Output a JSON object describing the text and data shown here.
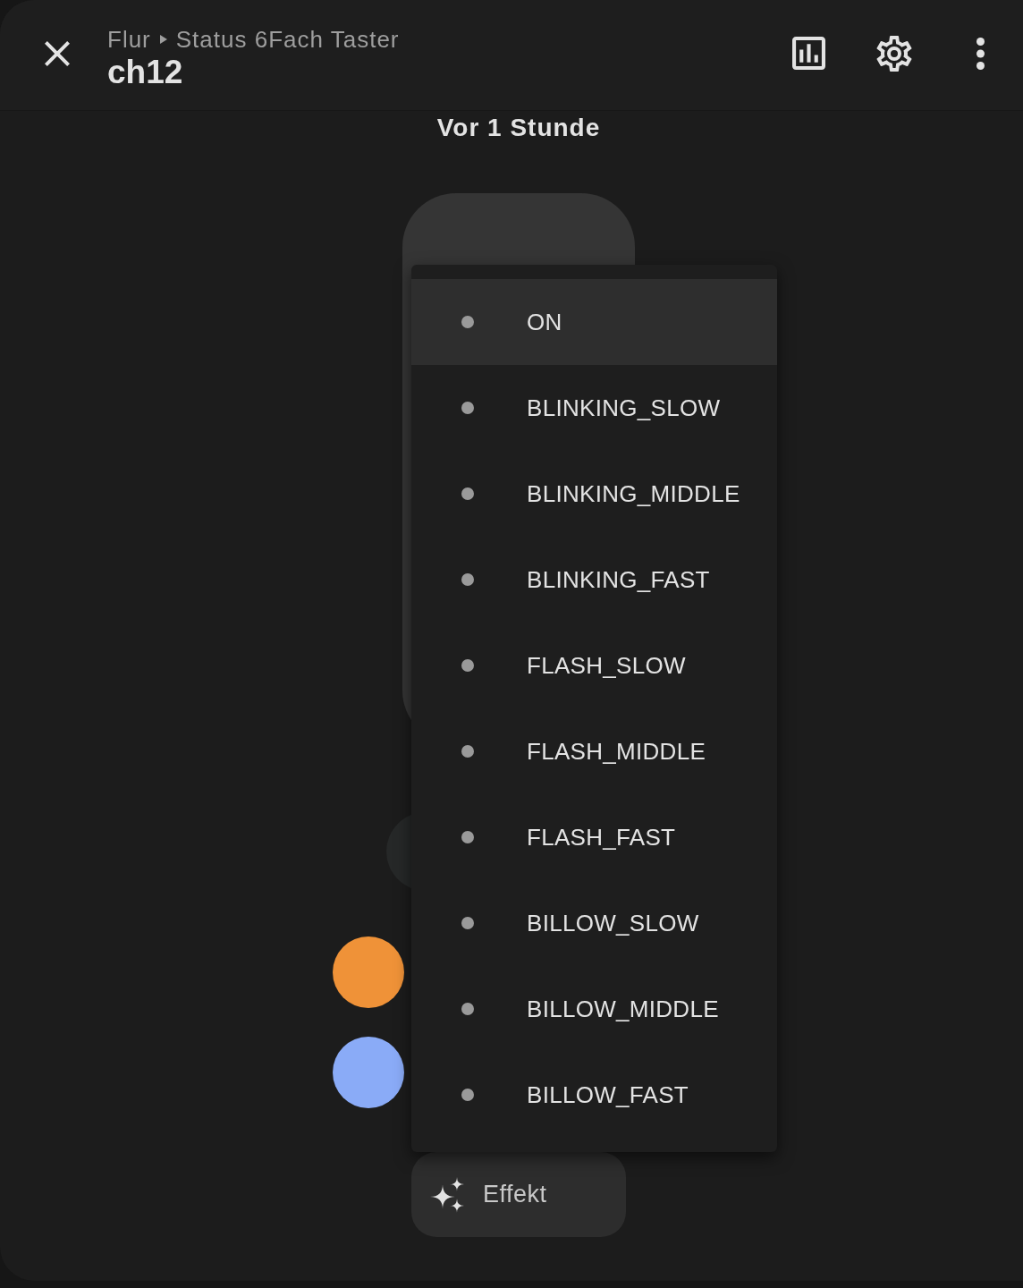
{
  "header": {
    "breadcrumb": [
      "Flur",
      "Status 6Fach Taster"
    ],
    "title": "ch12"
  },
  "last_changed": "Vor 1 Stunde",
  "favorite_colors": [
    {
      "color": "#ef9238"
    },
    {
      "color": "#8aabf7"
    }
  ],
  "effect_button": {
    "label": "Effekt"
  },
  "effect_menu": {
    "items": [
      {
        "label": "ON",
        "selected": true
      },
      {
        "label": "BLINKING_SLOW",
        "selected": false
      },
      {
        "label": "BLINKING_MIDDLE",
        "selected": false
      },
      {
        "label": "BLINKING_FAST",
        "selected": false
      },
      {
        "label": "FLASH_SLOW",
        "selected": false
      },
      {
        "label": "FLASH_MIDDLE",
        "selected": false
      },
      {
        "label": "FLASH_FAST",
        "selected": false
      },
      {
        "label": "BILLOW_SLOW",
        "selected": false
      },
      {
        "label": "BILLOW_MIDDLE",
        "selected": false
      },
      {
        "label": "BILLOW_FAST",
        "selected": false
      }
    ]
  }
}
